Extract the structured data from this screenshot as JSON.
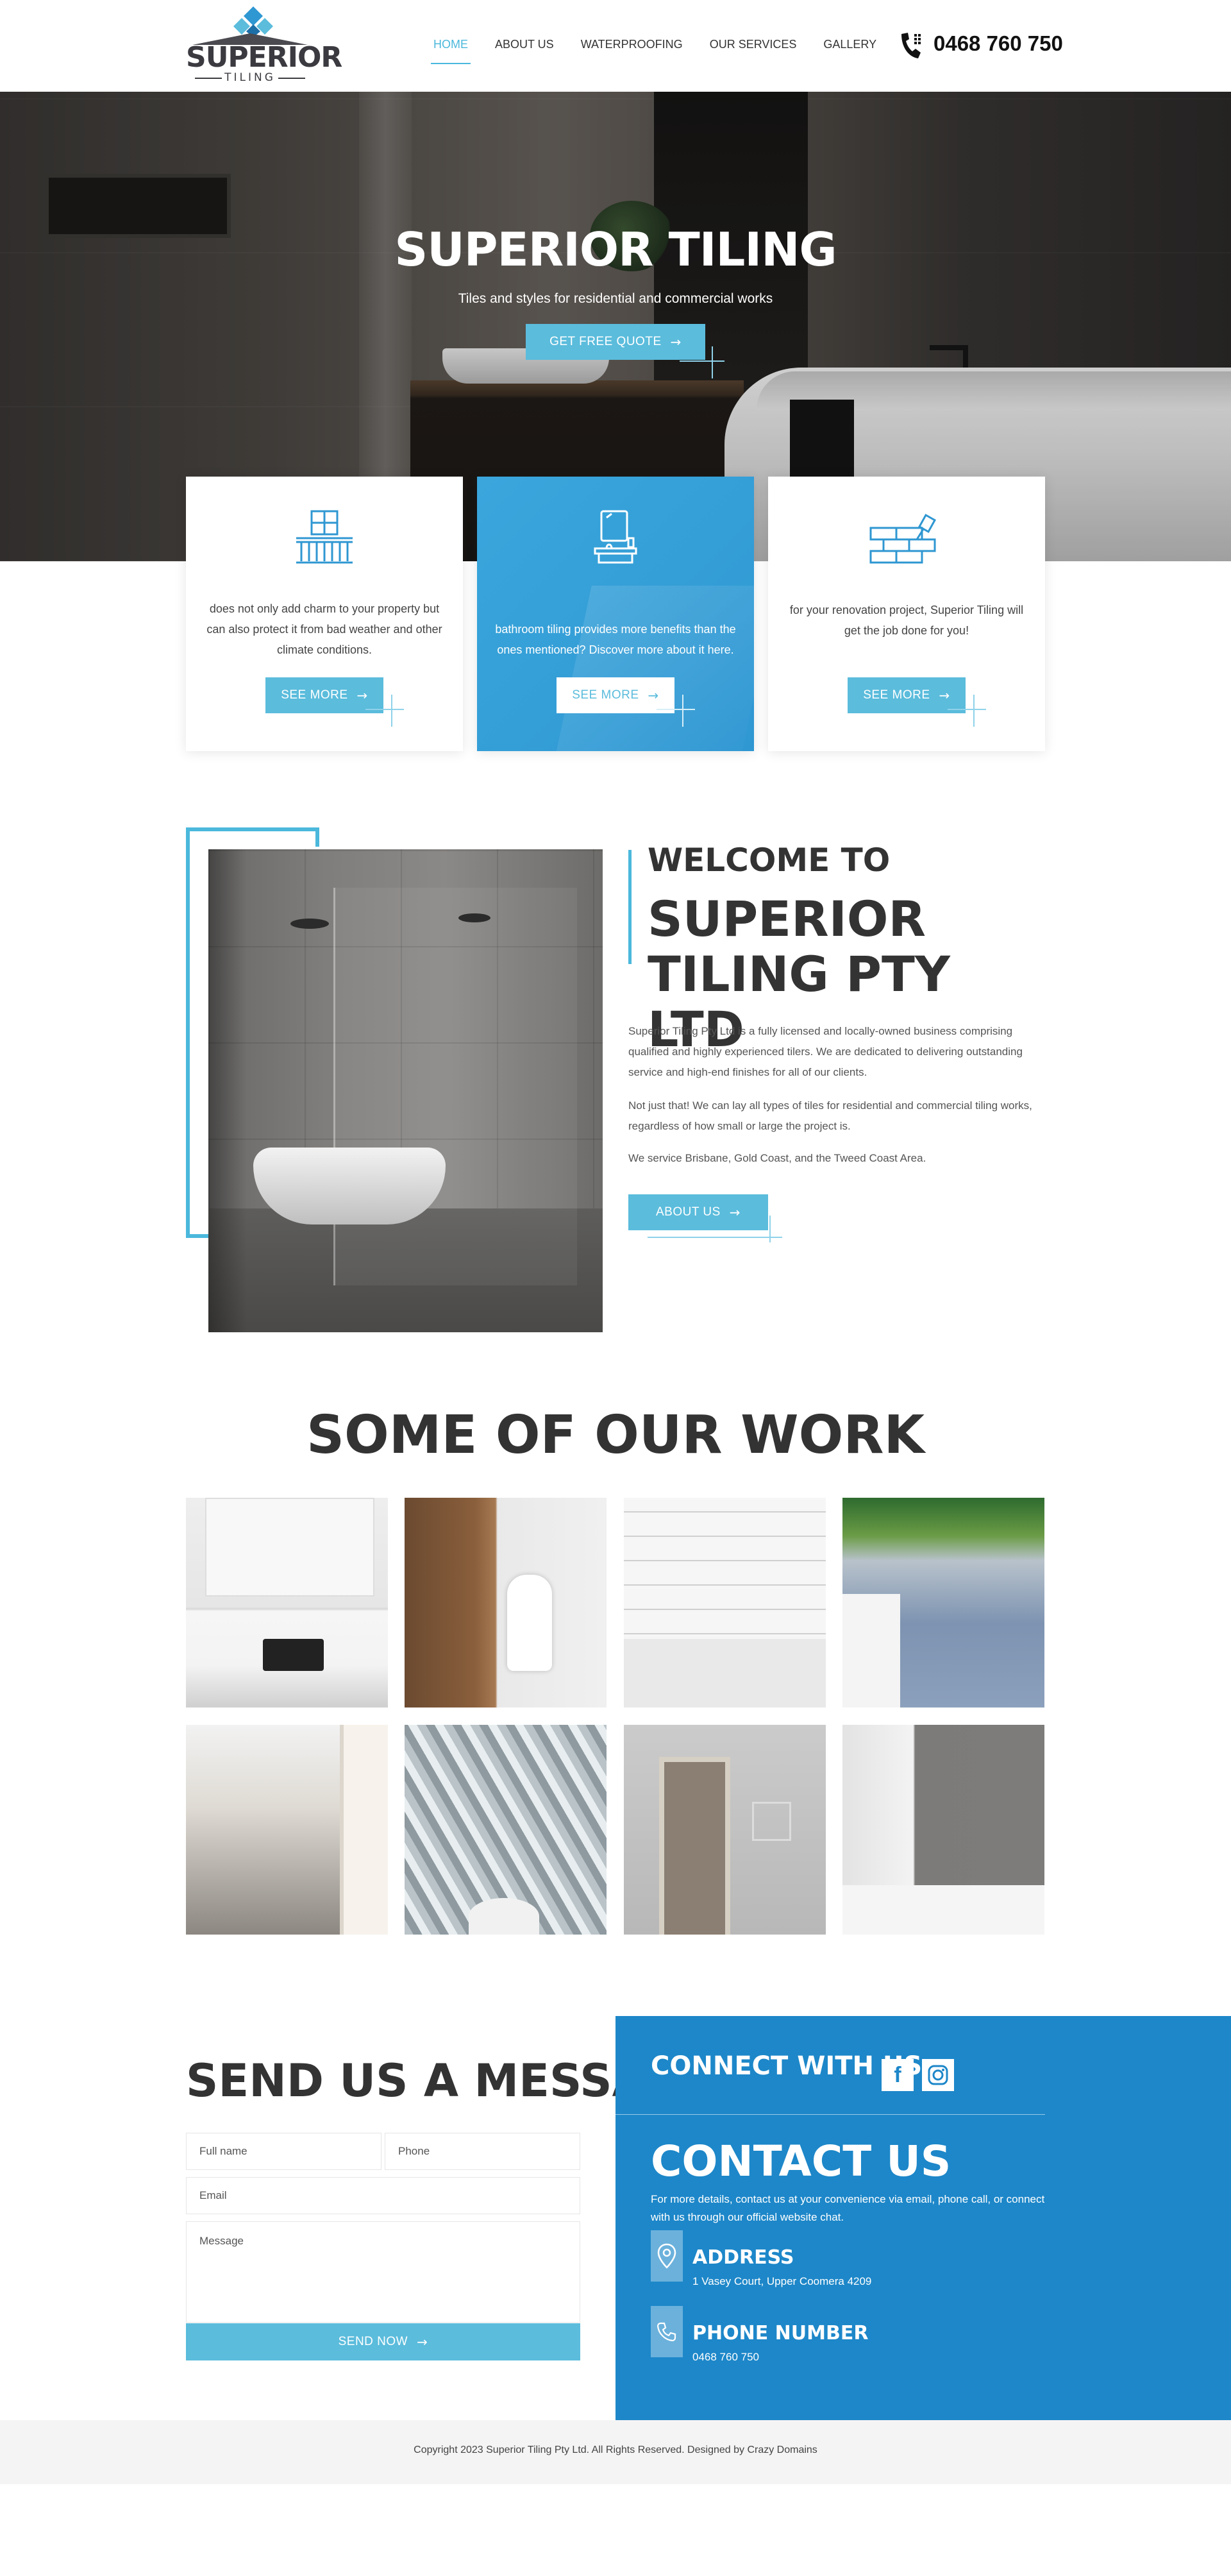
{
  "header": {
    "logo_text": "SUPERIOR",
    "logo_sub": "TILING",
    "nav": [
      {
        "label": "HOME",
        "active": true
      },
      {
        "label": "ABOUT US"
      },
      {
        "label": "WATERPROOFING"
      },
      {
        "label": "OUR SERVICES"
      },
      {
        "label": "GALLERY"
      }
    ],
    "phone": "0468 760 750",
    "phone_icon": "telephone-icon"
  },
  "hero": {
    "title": "SUPERIOR TILING",
    "subtitle": "Tiles and styles for residential and commercial works",
    "cta": "GET FREE QUOTE"
  },
  "cards": [
    {
      "icon": "balcony-icon",
      "text": "does not only add charm to your property but can also protect it from bad weather and other climate conditions.",
      "button": "SEE MORE"
    },
    {
      "icon": "bathroom-icon",
      "text": "bathroom tiling provides more benefits than the ones mentioned? Discover more about it here.",
      "button": "SEE MORE"
    },
    {
      "icon": "brick-wall-icon",
      "text": "for your renovation project, Superior Tiling will get the job done for you!",
      "button": "SEE MORE"
    }
  ],
  "welcome": {
    "kicker": "WELCOME TO",
    "title": "SUPERIOR TILING PTY LTD",
    "paragraphs": [
      "Superior Tiling Pty Ltd is a fully licensed and locally-owned business comprising qualified and highly experienced tilers. We are dedicated to delivering outstanding service and high-end finishes for all of our clients.",
      "Not just that! We can lay all types of tiles for residential and commercial tiling works, regardless of how small or large the project is.",
      "We service Brisbane, Gold Coast, and the Tweed Coast Area."
    ],
    "button": "ABOUT US"
  },
  "work": {
    "title": "SOME OF OUR WORK"
  },
  "message_form": {
    "title": "SEND US A MESSAGE",
    "full_name_placeholder": "Full name",
    "phone_placeholder": "Phone",
    "email_placeholder": "Email",
    "message_placeholder": "Message",
    "submit": "SEND NOW"
  },
  "contact": {
    "connect_label": "CONNECT WITH US:",
    "social": [
      "facebook-icon",
      "instagram-icon"
    ],
    "title": "CONTACT US",
    "description": "For more details, contact us at your convenience via email, phone call, or connect with us through our official website chat.",
    "address_label": "ADDRESS",
    "address": "1 Vasey Court, Upper Coomera 4209",
    "phone_label": "PHONE NUMBER",
    "phone": "0468 760 750"
  },
  "footer": {
    "copyright": "Copyright 2023 Superior Tiling Pty Ltd. All Rights Reserved. Designed by Crazy Domains"
  },
  "colors": {
    "accent": "#5bbcdc",
    "panel_blue": "#1d87c9",
    "dark_text": "#333333"
  }
}
